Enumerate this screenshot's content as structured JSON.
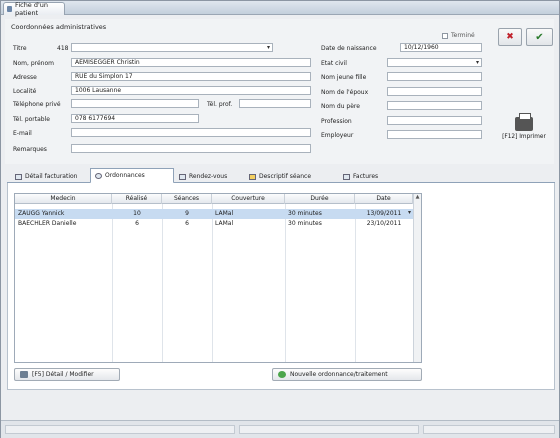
{
  "window": {
    "title": "Fiche d'un patient"
  },
  "group": {
    "label": "Coordonnées administratives"
  },
  "form": {
    "titre": {
      "label": "Titre",
      "code": "418",
      "value": ""
    },
    "nom_prenom": {
      "label": "Nom, prénom",
      "value": "AEMISEGGER Christin"
    },
    "adresse": {
      "label": "Adresse",
      "value": "RUE du Simplon 17"
    },
    "localite": {
      "label": "Localité",
      "value": "1006 Lausanne"
    },
    "tel_prive": {
      "label": "Téléphone privé",
      "value": ""
    },
    "tel_prof": {
      "label": "Tél. prof.",
      "value": ""
    },
    "tel_portable": {
      "label": "Tél. portable",
      "value": "078 6177694"
    },
    "email": {
      "label": "E-mail",
      "value": ""
    },
    "remarques": {
      "label": "Remarques",
      "value": ""
    },
    "date_naissance": {
      "label": "Date de naissance",
      "value": "10/12/1960"
    },
    "etat_civil": {
      "label": "Etat civil",
      "value": ""
    },
    "nom_jeune_fille": {
      "label": "Nom jeune fille",
      "value": ""
    },
    "nom_epoux": {
      "label": "Nom de l'époux",
      "value": ""
    },
    "nom_pere": {
      "label": "Nom du père",
      "value": ""
    },
    "profession": {
      "label": "Profession",
      "value": ""
    },
    "employeur": {
      "label": "Employeur",
      "value": ""
    },
    "termine": {
      "label": "Terminé",
      "checked": false
    }
  },
  "actions": {
    "cancel_symbol": "✖",
    "ok_symbol": "✔",
    "print_label": "[F12] Imprimer"
  },
  "tabs": [
    {
      "label": "Détail facturation",
      "active": false
    },
    {
      "label": "Ordonnances",
      "active": true
    },
    {
      "label": "Rendez-vous",
      "active": false
    },
    {
      "label": "Descriptif séance",
      "active": false
    },
    {
      "label": "Factures",
      "active": false
    }
  ],
  "table": {
    "columns": [
      "Medecin",
      "Réalisé",
      "Séances",
      "Couverture",
      "Durée",
      "Date"
    ],
    "rows": [
      [
        "ZAUGG Yannick",
        "10",
        "9",
        "LAMal",
        "30 minutes",
        "13/09/2011"
      ],
      [
        "BAECHLER Danielle",
        "6",
        "6",
        "LAMal",
        "30 minutes",
        "23/10/2011"
      ]
    ],
    "selected_row": 0
  },
  "buttons": {
    "detail": "[F5] Détail / Modifier",
    "nouvelle": "Nouvelle ordonnance/traitement"
  },
  "colors": {
    "selection": "#c7dbf1",
    "ok_green": "#2a7a2a",
    "cancel_red": "#c0202a"
  }
}
